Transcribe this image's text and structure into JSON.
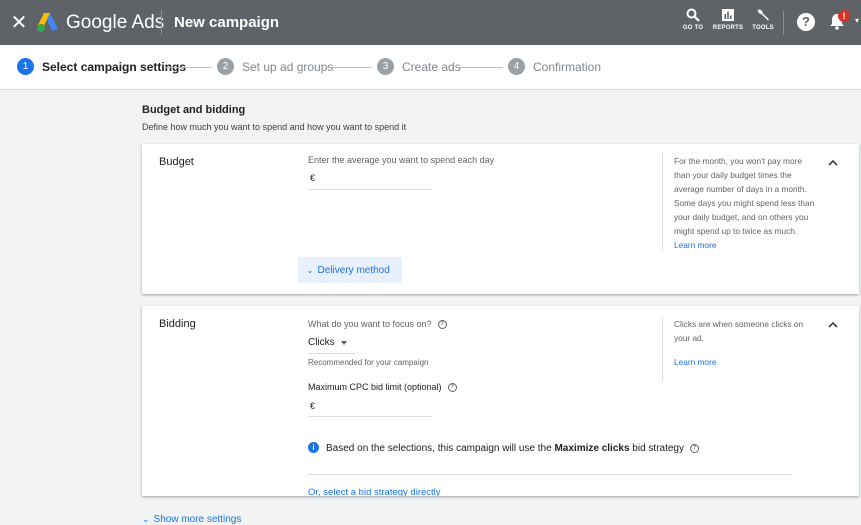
{
  "header": {
    "brand": "Google Ads",
    "title": "New campaign",
    "tools": [
      {
        "label": "GO TO",
        "icon": "search-icon"
      },
      {
        "label": "REPORTS",
        "icon": "reports-icon"
      },
      {
        "label": "TOOLS",
        "icon": "wrench-icon"
      }
    ],
    "help_glyph": "?",
    "notification_badge": "!"
  },
  "stepper": {
    "steps": [
      {
        "num": "1",
        "label": "Select campaign settings",
        "active": true
      },
      {
        "num": "2",
        "label": "Set up ad groups",
        "active": false
      },
      {
        "num": "3",
        "label": "Create ads",
        "active": false
      },
      {
        "num": "4",
        "label": "Confirmation",
        "active": false
      }
    ]
  },
  "section": {
    "title": "Budget and bidding",
    "subtitle": "Define how much you want to spend and how you want to spend it"
  },
  "budget": {
    "label": "Budget",
    "hint": "Enter the average you want to spend each day",
    "currency": "€",
    "side_text": "For the month, you won't pay more than your daily budget times the average number of days in a month. Some days you might spend less than your daily budget, and on others you might spend up to twice as much.",
    "side_link": "Learn more",
    "delivery_label": "Delivery method"
  },
  "bidding": {
    "label": "Bidding",
    "focus_question": "What do you want to focus on?",
    "focus_value": "Clicks",
    "recommended": "Recommended for your campaign",
    "max_cpc_label": "Maximum CPC bid limit (optional)",
    "currency": "€",
    "info_prefix": "Based on the selections, this campaign will use the ",
    "info_bold": "Maximize clicks",
    "info_suffix": " bid strategy",
    "bid_link": "Or, select a bid strategy directly",
    "side_text": "Clicks are when someone clicks on your ad.",
    "side_link": "Learn more"
  },
  "show_more": "Show more settings",
  "colors": {
    "header_bg": "#5f6368",
    "accent": "#1a73e8",
    "page_bg": "#f1f3f4",
    "badge": "#d93025"
  }
}
